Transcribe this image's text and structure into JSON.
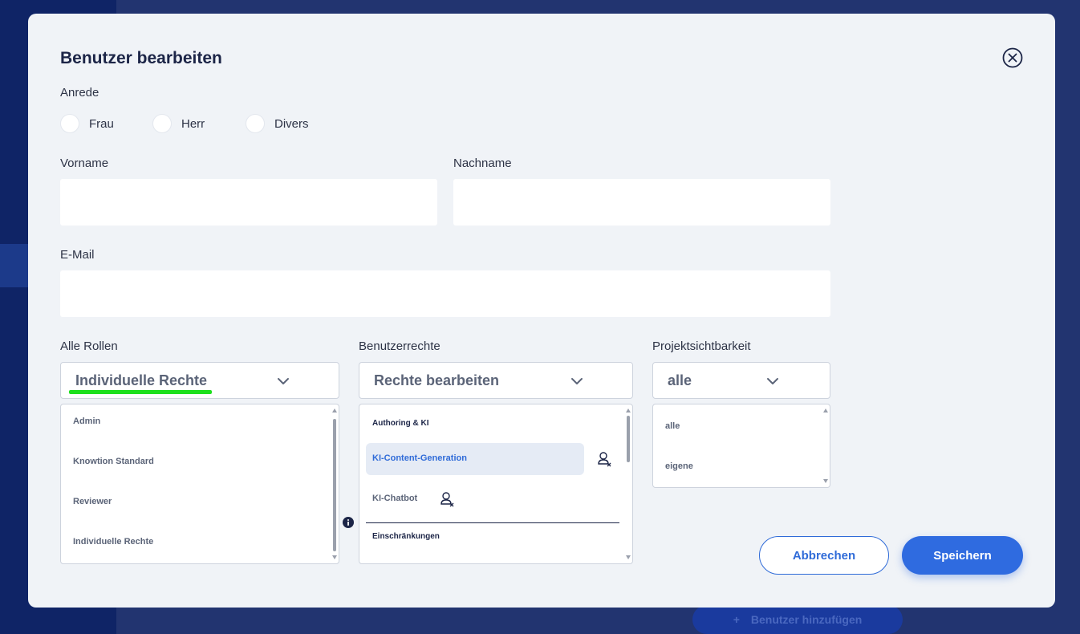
{
  "background": {
    "add_user_label": "Benutzer hinzufügen",
    "add_icon": "plus-icon"
  },
  "modal": {
    "title": "Benutzer bearbeiten",
    "close_icon": "close-circle-icon"
  },
  "salutation": {
    "label": "Anrede",
    "options": [
      "Frau",
      "Herr",
      "Divers"
    ]
  },
  "first_name": {
    "label": "Vorname",
    "value": ""
  },
  "last_name": {
    "label": "Nachname",
    "value": ""
  },
  "email": {
    "label": "E-Mail",
    "value": ""
  },
  "roles": {
    "label": "Alle Rollen",
    "selected": "Individuelle Rechte",
    "options": [
      "Admin",
      "Knowtion Standard",
      "Reviewer",
      "Individuelle Rechte"
    ]
  },
  "user_rights": {
    "label": "Benutzerrechte",
    "selected": "Rechte bearbeiten",
    "section_authoring": "Authoring & KI",
    "item_content_generation": "KI-Content-Generation",
    "item_chatbot": "KI-Chatbot",
    "section_restrictions": "Einschränkungen",
    "item_icon": "user-remove-icon"
  },
  "project_visibility": {
    "label": "Projektsichtbarkeit",
    "selected": "alle",
    "options": [
      "alle",
      "eigene"
    ]
  },
  "info_icon": "info-icon",
  "actions": {
    "cancel": "Abbrechen",
    "save": "Speichern"
  },
  "colors": {
    "accent": "#2f6be0",
    "highlight": "#1de01d",
    "backdrop": "#223470"
  }
}
